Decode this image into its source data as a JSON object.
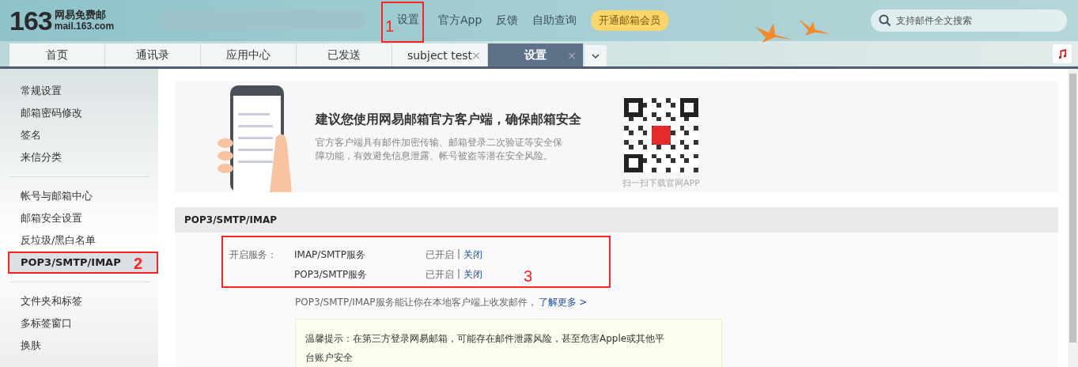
{
  "header": {
    "logo_number": "163",
    "logo_name": "网易免费邮",
    "logo_domain": "mail.163.com",
    "nav": [
      {
        "label": "设置",
        "annotation": "1"
      },
      {
        "label": "官方App"
      },
      {
        "label": "反馈"
      },
      {
        "label": "自助查询"
      }
    ],
    "vip_button": "开通邮箱会员",
    "search": {
      "placeholder": "支持邮件全文搜索"
    }
  },
  "tabs": [
    {
      "label": "首页",
      "selected": false
    },
    {
      "label": "通讯录",
      "selected": false
    },
    {
      "label": "应用中心",
      "selected": false
    },
    {
      "label": "已发送",
      "selected": false
    },
    {
      "label": "subject  test",
      "selected": false,
      "close": "×"
    },
    {
      "label": "设置",
      "selected": true,
      "close": "×"
    }
  ],
  "sidebar": {
    "groups": [
      [
        {
          "label": "常规设置",
          "selected": false
        },
        {
          "label": "邮箱密码修改",
          "selected": false
        },
        {
          "label": "签名",
          "selected": false
        },
        {
          "label": "来信分类",
          "selected": false
        }
      ],
      [
        {
          "label": "帐号与邮箱中心",
          "selected": false
        },
        {
          "label": "邮箱安全设置",
          "selected": false
        },
        {
          "label": "反垃圾/黑白名单",
          "selected": false
        },
        {
          "label": "POP3/SMTP/IMAP",
          "selected": true,
          "annotation": "2"
        }
      ],
      [
        {
          "label": "文件夹和标签",
          "selected": false
        },
        {
          "label": "多标签窗口",
          "selected": false
        },
        {
          "label": "换肤",
          "selected": false
        }
      ]
    ]
  },
  "banner": {
    "title": "建议您使用网易邮箱官方客户端，确保邮箱安全",
    "description": "官方客户端具有邮件加密传输、邮箱登录二次验证等安全保障功能，有效避免信息泄露、帐号被盗等潜在安全风险。",
    "qr_caption": "扫一扫下载官网APP"
  },
  "section": {
    "title": "POP3/SMTP/IMAP",
    "services_label": "开启服务：",
    "annotation": "3",
    "services": [
      {
        "name": "IMAP/SMTP服务",
        "status": "已开启",
        "separator": "|",
        "action": "关闭"
      },
      {
        "name": "POP3/SMTP服务",
        "status": "已开启",
        "separator": "|",
        "action": "关闭"
      }
    ],
    "description": "POP3/SMTP/IMAP服务能让你在本地客户端上收发邮件，",
    "learn_more": "了解更多 >",
    "tip": "温馨提示：在第三方登录网易邮箱，可能存在邮件泄露风险，甚至危害Apple或其他平台账户安全"
  }
}
